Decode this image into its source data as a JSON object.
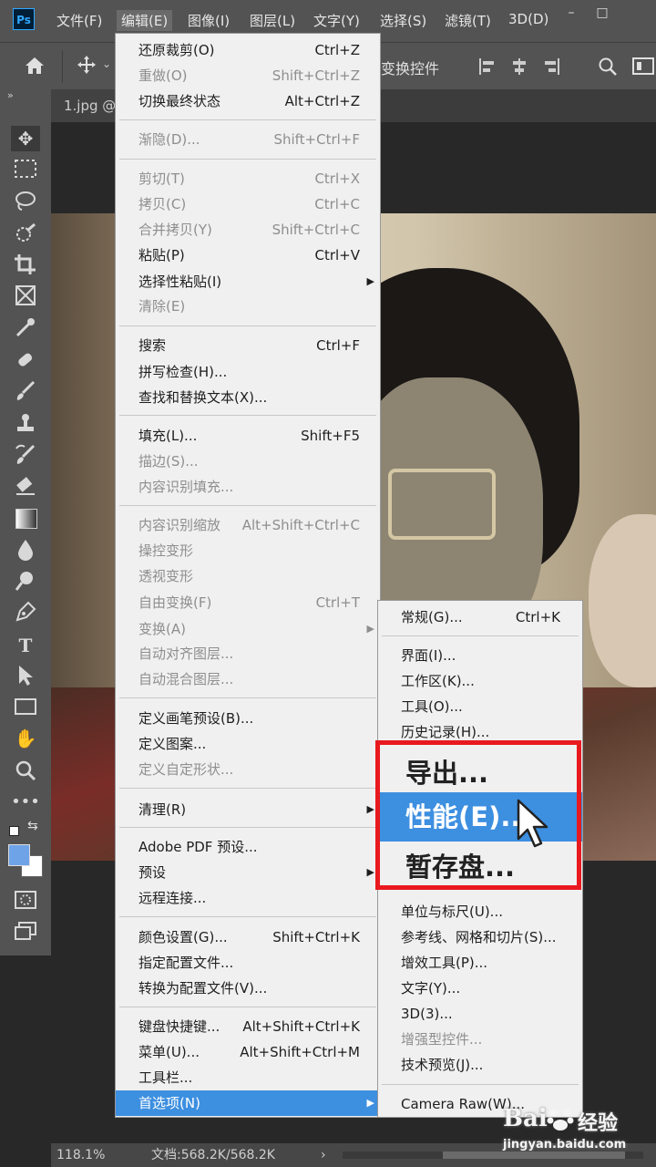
{
  "app": {
    "logo": "Ps"
  },
  "menubar": {
    "items": [
      "文件(F)",
      "编辑(E)",
      "图像(I)",
      "图层(L)",
      "文字(Y)",
      "选择(S)",
      "滤镜(T)",
      "3D(D)"
    ],
    "active": "编辑(E)",
    "window_controls": [
      "–",
      "□"
    ]
  },
  "options_bar": {
    "transform_controls": "变换控件"
  },
  "document": {
    "tab_label": "1.jpg @"
  },
  "status": {
    "zoom": "118.1%",
    "doc_info": "文档:568.2K/568.2K",
    "arrow": "›"
  },
  "edit_menu": {
    "items": [
      {
        "label": "还原裁剪(O)",
        "shortcut": "Ctrl+Z",
        "enabled": true
      },
      {
        "label": "重做(O)",
        "shortcut": "Shift+Ctrl+Z",
        "enabled": false
      },
      {
        "label": "切换最终状态",
        "shortcut": "Alt+Ctrl+Z",
        "enabled": true
      },
      {
        "label": "渐隐(D)...",
        "shortcut": "Shift+Ctrl+F",
        "enabled": false
      },
      {
        "label": "剪切(T)",
        "shortcut": "Ctrl+X",
        "enabled": false
      },
      {
        "label": "拷贝(C)",
        "shortcut": "Ctrl+C",
        "enabled": false
      },
      {
        "label": "合并拷贝(Y)",
        "shortcut": "Shift+Ctrl+C",
        "enabled": false
      },
      {
        "label": "粘贴(P)",
        "shortcut": "Ctrl+V",
        "enabled": true
      },
      {
        "label": "选择性粘贴(I)",
        "shortcut": "",
        "enabled": true,
        "submenu": true
      },
      {
        "label": "清除(E)",
        "shortcut": "",
        "enabled": false
      },
      {
        "label": "搜索",
        "shortcut": "Ctrl+F",
        "enabled": true
      },
      {
        "label": "拼写检查(H)...",
        "shortcut": "",
        "enabled": true
      },
      {
        "label": "查找和替换文本(X)...",
        "shortcut": "",
        "enabled": true
      },
      {
        "label": "填充(L)...",
        "shortcut": "Shift+F5",
        "enabled": true
      },
      {
        "label": "描边(S)...",
        "shortcut": "",
        "enabled": false
      },
      {
        "label": "内容识别填充...",
        "shortcut": "",
        "enabled": false
      },
      {
        "label": "内容识别缩放",
        "shortcut": "Alt+Shift+Ctrl+C",
        "enabled": false
      },
      {
        "label": "操控变形",
        "shortcut": "",
        "enabled": false
      },
      {
        "label": "透视变形",
        "shortcut": "",
        "enabled": false
      },
      {
        "label": "自由变换(F)",
        "shortcut": "Ctrl+T",
        "enabled": false
      },
      {
        "label": "变换(A)",
        "shortcut": "",
        "enabled": false,
        "submenu": true
      },
      {
        "label": "自动对齐图层...",
        "shortcut": "",
        "enabled": false
      },
      {
        "label": "自动混合图层...",
        "shortcut": "",
        "enabled": false
      },
      {
        "label": "定义画笔预设(B)...",
        "shortcut": "",
        "enabled": true
      },
      {
        "label": "定义图案...",
        "shortcut": "",
        "enabled": true
      },
      {
        "label": "定义自定形状...",
        "shortcut": "",
        "enabled": false
      },
      {
        "label": "清理(R)",
        "shortcut": "",
        "enabled": true,
        "submenu": true
      },
      {
        "label": "Adobe PDF 预设...",
        "shortcut": "",
        "enabled": true
      },
      {
        "label": "预设",
        "shortcut": "",
        "enabled": true,
        "submenu": true
      },
      {
        "label": "远程连接...",
        "shortcut": "",
        "enabled": true
      },
      {
        "label": "颜色设置(G)...",
        "shortcut": "Shift+Ctrl+K",
        "enabled": true
      },
      {
        "label": "指定配置文件...",
        "shortcut": "",
        "enabled": true
      },
      {
        "label": "转换为配置文件(V)...",
        "shortcut": "",
        "enabled": true
      },
      {
        "label": "键盘快捷键...",
        "shortcut": "Alt+Shift+Ctrl+K",
        "enabled": true
      },
      {
        "label": "菜单(U)...",
        "shortcut": "Alt+Shift+Ctrl+M",
        "enabled": true
      },
      {
        "label": "工具栏...",
        "shortcut": "",
        "enabled": true
      },
      {
        "label": "首选项(N)",
        "shortcut": "",
        "enabled": true,
        "submenu": true,
        "highlighted": true
      }
    ]
  },
  "preferences_menu": {
    "items": [
      {
        "label": "常规(G)...",
        "shortcut": "Ctrl+K",
        "enabled": true
      },
      {
        "label": "界面(I)...",
        "shortcut": "",
        "enabled": true
      },
      {
        "label": "工作区(K)...",
        "shortcut": "",
        "enabled": true
      },
      {
        "label": "工具(O)...",
        "shortcut": "",
        "enabled": true
      },
      {
        "label": "历史记录(H)...",
        "shortcut": "",
        "enabled": true
      },
      {
        "label": "导出...",
        "shortcut": "",
        "enabled": true,
        "emphasized": true
      },
      {
        "label": "性能(E)...",
        "shortcut": "",
        "enabled": true,
        "emphasized": true,
        "highlighted": true
      },
      {
        "label": "暂存盘...",
        "shortcut": "",
        "enabled": true,
        "emphasized": true
      },
      {
        "label": "单位与标尺(U)...",
        "shortcut": "",
        "enabled": true
      },
      {
        "label": "参考线、网格和切片(S)...",
        "shortcut": "",
        "enabled": true
      },
      {
        "label": "增效工具(P)...",
        "shortcut": "",
        "enabled": true
      },
      {
        "label": "文字(Y)...",
        "shortcut": "",
        "enabled": true
      },
      {
        "label": "3D(3)...",
        "shortcut": "",
        "enabled": true
      },
      {
        "label": "增强型控件...",
        "shortcut": "",
        "enabled": false
      },
      {
        "label": "技术预览(J)...",
        "shortcut": "",
        "enabled": true
      },
      {
        "label": "Camera Raw(W)...",
        "shortcut": "",
        "enabled": true
      }
    ]
  },
  "watermark": {
    "brand": "Bai",
    "brand_cn": "经验",
    "url": "jingyan.baidu.com"
  },
  "colors": {
    "menu_bg": "#f0f0f0",
    "highlight": "#3d8fe0",
    "annotation_red": "#e8191f",
    "ui_dark": "#535353",
    "foreground_swatch": "#6fa3e8"
  }
}
